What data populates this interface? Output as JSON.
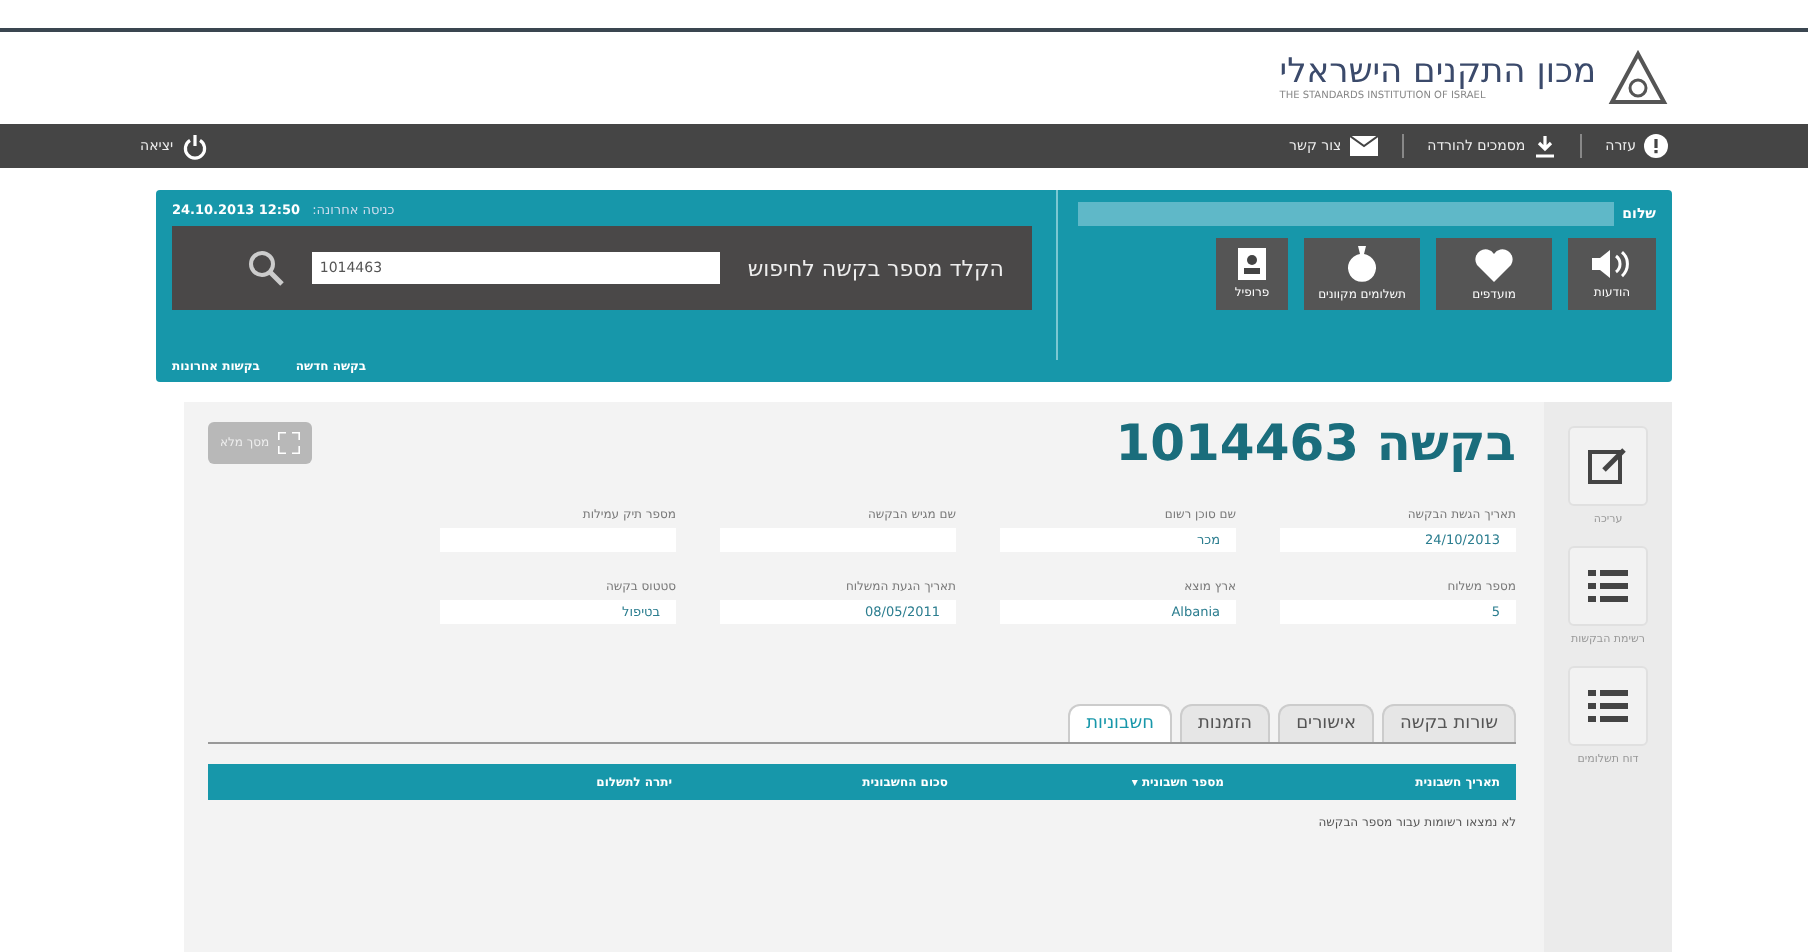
{
  "logo": {
    "title": "מכון התקנים הישראלי",
    "subtitle": "THE STANDARDS INSTITUTION OF ISRAEL"
  },
  "top_bar": {
    "links": [
      {
        "kind": "help",
        "label": "עזרה"
      },
      {
        "kind": "download",
        "label": "מסמכים להורדה"
      },
      {
        "kind": "mail",
        "label": "צור קשר"
      }
    ],
    "logout": "יציאה"
  },
  "user_panel": {
    "greeting": "שלום",
    "last_login_label": "כניסה אחרונה:",
    "last_login": "12:50 24.10.2013",
    "shortcuts": [
      {
        "kind": "speaker",
        "label": "הודעות"
      },
      {
        "kind": "heart",
        "label": "מועדפים"
      },
      {
        "kind": "bag",
        "label": "תשלומים מקוונים"
      },
      {
        "kind": "contact",
        "label": "פרופיל"
      }
    ],
    "search": {
      "label": "הקלד מספר בקשה לחיפוש",
      "value": "1014463"
    },
    "links": [
      "בקשה חדשה",
      "בקשות אחרונות"
    ]
  },
  "sidebar": [
    {
      "kind": "edit",
      "label": "עריכה"
    },
    {
      "kind": "list",
      "label": "רשימת הבקשות"
    },
    {
      "kind": "list",
      "label": "דוח תשלומים"
    }
  ],
  "request": {
    "title": "בקשה 1014463",
    "fullscreen": "מסך מלא",
    "fields": [
      {
        "label": "תאריך הגשת הבקשה",
        "value": "24/10/2013"
      },
      {
        "label": "שם סוכן רשום",
        "value": "מכר"
      },
      {
        "label": "שם מגיש הבקשה"
      },
      {
        "label": "מספר תיק עמילות"
      },
      {
        "label": "מספר משלוח",
        "value": "5"
      },
      {
        "label": "ארץ מוצא",
        "value": "Albania"
      },
      {
        "label": "תאריך הגעת המשלוח",
        "value": "08/05/2011"
      },
      {
        "label": "סטטוס בקשה",
        "value": "בטיפול"
      }
    ]
  },
  "tabs": [
    {
      "label": "שורות בקשה",
      "selected": false
    },
    {
      "label": "אישורים",
      "selected": false
    },
    {
      "label": "הזמנות",
      "selected": false
    },
    {
      "label": "חשבוניות",
      "selected": true
    }
  ],
  "table": {
    "columns": [
      "תאריך חשבונית",
      "מספר חשבונית ▾",
      "סכום החשבונית",
      "יתרה לתשלום"
    ],
    "empty_message": "לא נמצאו רשומות עבור מספר הבקשה"
  }
}
